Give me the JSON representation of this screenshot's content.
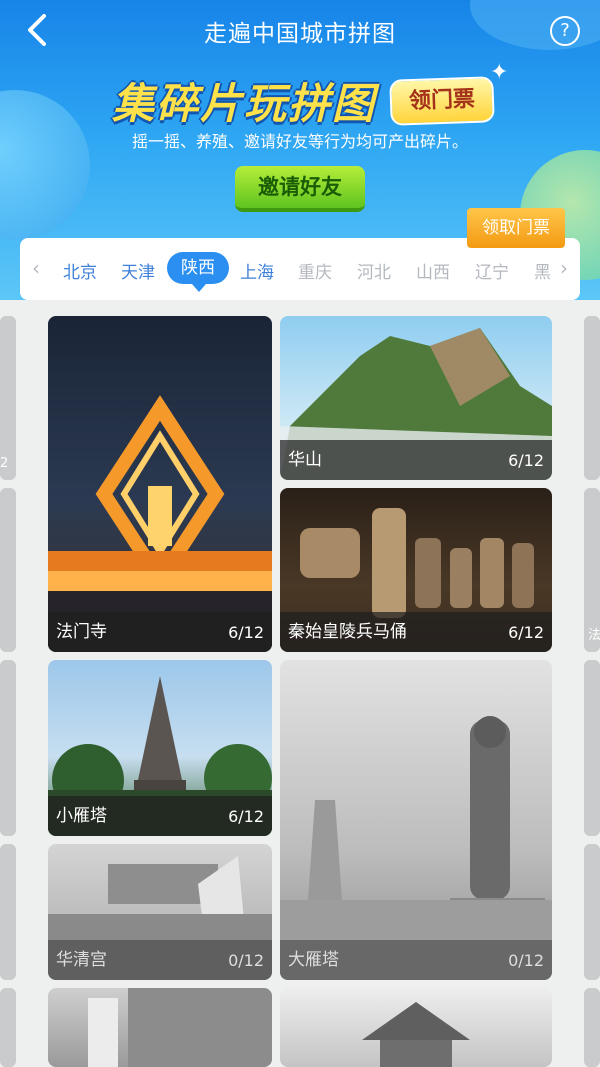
{
  "header": {
    "title": "走遍中国城市拼图",
    "help": "?"
  },
  "banner": {
    "slogan": "集碎片玩拼图",
    "ticket_badge": "领门票",
    "subtitle": "摇一摇、养殖、邀请好友等行为均可产出碎片。"
  },
  "invite_button": "邀请好友",
  "claim_button": "领取门票",
  "tabs": [
    {
      "label": "北京"
    },
    {
      "label": "天津"
    },
    {
      "label": "陕西"
    },
    {
      "label": "上海"
    },
    {
      "label": "重庆"
    },
    {
      "label": "河北"
    },
    {
      "label": "山西"
    },
    {
      "label": "辽宁"
    },
    {
      "label": "黑"
    }
  ],
  "selected_tab": "陕西",
  "cards": [
    {
      "name": "法门寺",
      "progress": "6/12"
    },
    {
      "name": "华山",
      "progress": "6/12"
    },
    {
      "name": "秦始皇陵兵马俑",
      "progress": "6/12"
    },
    {
      "name": "小雁塔",
      "progress": "6/12"
    },
    {
      "name": "华清宫",
      "progress": "0/12"
    },
    {
      "name": "大雁塔",
      "progress": "0/12"
    }
  ],
  "side_peek": {
    "left_progress": "2",
    "right_name": "法"
  },
  "colors": {
    "accent": "#2a8ff0",
    "invite_green": "#5fc41f",
    "claim_orange": "#f39a12",
    "slogan_yellow": "#ffe24a"
  }
}
